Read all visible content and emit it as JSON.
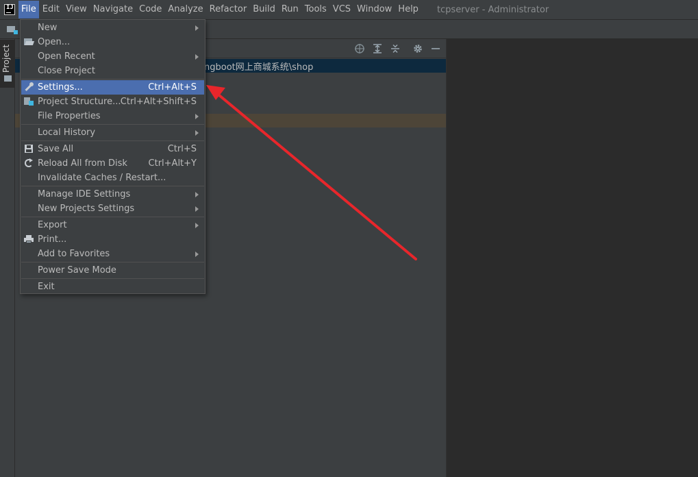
{
  "menubar": {
    "items": [
      {
        "label": "File"
      },
      {
        "label": "Edit"
      },
      {
        "label": "View"
      },
      {
        "label": "Navigate"
      },
      {
        "label": "Code"
      },
      {
        "label": "Analyze"
      },
      {
        "label": "Refactor"
      },
      {
        "label": "Build"
      },
      {
        "label": "Run"
      },
      {
        "label": "Tools"
      },
      {
        "label": "VCS"
      },
      {
        "label": "Window"
      },
      {
        "label": "Help"
      }
    ],
    "window_title": "tcpserver - Administrator"
  },
  "app_logo": "IJ",
  "left_strip": {
    "project_tab_label": "Project"
  },
  "project_panel": {
    "path_text": "ngboot网上商城系统\\shop",
    "header_icons": [
      "locate-icon",
      "expand-all-icon",
      "collapse-all-icon",
      "gear-icon",
      "minimize-icon"
    ]
  },
  "file_menu": {
    "items": [
      {
        "label": "New",
        "shortcut": "",
        "submenu": true
      },
      {
        "label": "Open...",
        "shortcut": "",
        "submenu": false,
        "icon": "folder-open-icon"
      },
      {
        "label": "Open Recent",
        "shortcut": "",
        "submenu": true
      },
      {
        "label": "Close Project",
        "shortcut": "",
        "submenu": false
      },
      {
        "label": "Settings...",
        "shortcut": "Ctrl+Alt+S",
        "submenu": false,
        "icon": "wrench-icon",
        "selected": true
      },
      {
        "label": "Project Structure...",
        "shortcut": "Ctrl+Alt+Shift+S",
        "submenu": false,
        "icon": "structure-icon"
      },
      {
        "label": "File Properties",
        "shortcut": "",
        "submenu": true
      },
      {
        "label": "Local History",
        "shortcut": "",
        "submenu": true
      },
      {
        "label": "Save All",
        "shortcut": "Ctrl+S",
        "submenu": false,
        "icon": "save-icon"
      },
      {
        "label": "Reload All from Disk",
        "shortcut": "Ctrl+Alt+Y",
        "submenu": false,
        "icon": "reload-icon"
      },
      {
        "label": "Invalidate Caches / Restart...",
        "shortcut": "",
        "submenu": false
      },
      {
        "label": "Manage IDE Settings",
        "shortcut": "",
        "submenu": true
      },
      {
        "label": "New Projects Settings",
        "shortcut": "",
        "submenu": true
      },
      {
        "label": "Export",
        "shortcut": "",
        "submenu": true
      },
      {
        "label": "Print...",
        "shortcut": "",
        "submenu": false,
        "icon": "print-icon"
      },
      {
        "label": "Add to Favorites",
        "shortcut": "",
        "submenu": true
      },
      {
        "label": "Power Save Mode",
        "shortcut": "",
        "submenu": false
      },
      {
        "label": "Exit",
        "shortcut": "",
        "submenu": false
      }
    ]
  },
  "colors": {
    "selection": "#4b6eaf",
    "annotation_arrow": "#e8262b",
    "path_row": "#0d293e"
  }
}
